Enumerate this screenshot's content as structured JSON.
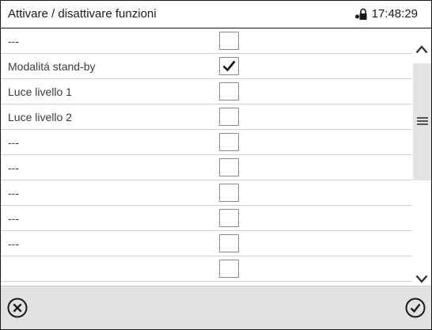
{
  "header": {
    "title": "Attivare / disattivare funzioni",
    "time": "17:48:29",
    "status_icon": "lock-icon"
  },
  "rows": [
    {
      "label": "---",
      "checked": false
    },
    {
      "label": "Modalitá stand-by",
      "checked": true
    },
    {
      "label": "Luce livello 1",
      "checked": false
    },
    {
      "label": "Luce livello 2",
      "checked": false
    },
    {
      "label": "---",
      "checked": false
    },
    {
      "label": "---",
      "checked": false
    },
    {
      "label": "---",
      "checked": false
    },
    {
      "label": "---",
      "checked": false
    },
    {
      "label": "---",
      "checked": false
    },
    {
      "label": "",
      "checked": false
    }
  ],
  "scrollbar": {
    "up_icon": "chevron-up-icon",
    "down_icon": "chevron-down-icon",
    "thumb_icon": "drag-handle-icon"
  },
  "footer": {
    "cancel_icon": "cancel-icon",
    "confirm_icon": "confirm-icon"
  },
  "colors": {
    "border": "#1a1a1a",
    "row_separator": "#d4d4d4",
    "checkbox_border": "#8a8a8a",
    "scroll_thumb": "#e3e3e3",
    "footer_bg": "#e2e2e2"
  }
}
